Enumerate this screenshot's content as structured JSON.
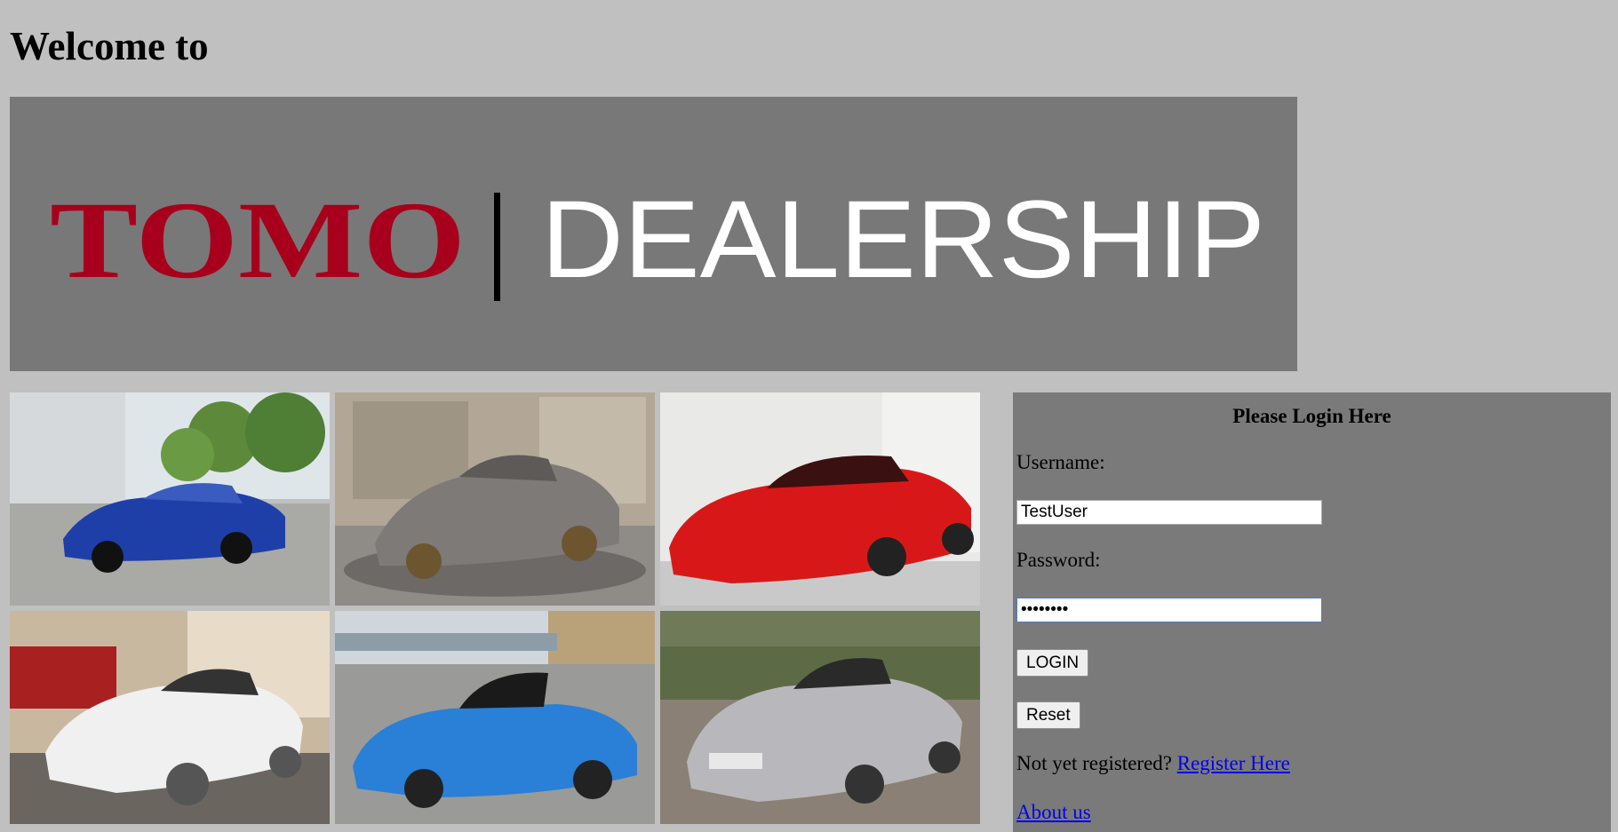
{
  "page": {
    "welcome_heading": "Welcome to"
  },
  "banner": {
    "brand_left": "TOMO",
    "brand_right": "DEALERSHIP",
    "colors": {
      "background": "#787878",
      "brand_left": "#a8001c",
      "brand_right": "#ffffff",
      "divider": "#000000"
    }
  },
  "gallery": {
    "photos": [
      {
        "subject": "blue coupe",
        "color": "#1f3fa8"
      },
      {
        "subject": "grey coupe",
        "color": "#7d7a78"
      },
      {
        "subject": "red coupe",
        "color": "#d81818"
      },
      {
        "subject": "white coupe",
        "color": "#f0f0f0"
      },
      {
        "subject": "blue roadster",
        "color": "#2a7fd6"
      },
      {
        "subject": "silver roadster",
        "color": "#b8b8bc"
      }
    ]
  },
  "login": {
    "title": "Please Login Here",
    "username_label": "Username:",
    "username_value": "TestUser",
    "password_label": "Password:",
    "password_value": "••••••••",
    "login_button": "LOGIN",
    "reset_button": "Reset",
    "register_prompt": "Not yet registered?",
    "register_link": "Register Here",
    "about_link": "About us"
  }
}
